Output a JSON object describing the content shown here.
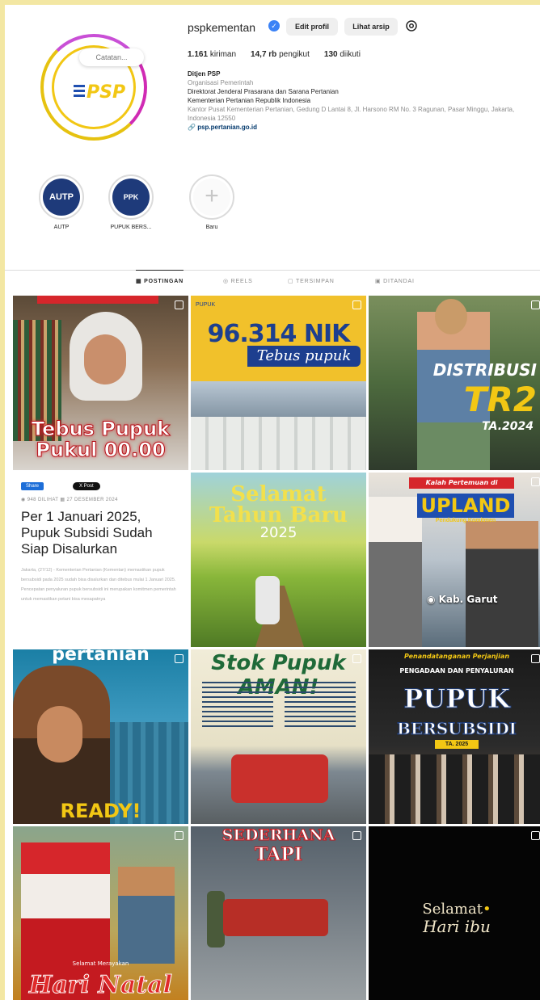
{
  "profile": {
    "username": "pspkementan",
    "note": "Catatan...",
    "avatar_text": "PSP",
    "buttons": {
      "edit": "Edit profil",
      "archive": "Lihat arsip"
    },
    "stats": {
      "posts": "1.161",
      "posts_label": "kiriman",
      "followers": "14,7 rb",
      "followers_label": "pengikut",
      "following": "130",
      "following_label": "diikuti"
    },
    "bio": {
      "name": "Ditjen PSP",
      "category": "Organisasi Pemerintah",
      "line1": "Direktorat Jenderal Prasarana dan Sarana Pertanian",
      "line2": "Kementerian Pertanian Republik Indonesia",
      "address": "Kantor Pusat Kementerian Pertanian, Gedung D Lantai 8, Jl. Harsono RM No. 3 Ragunan, Pasar Minggu, Jakarta, Indonesia 12550",
      "link": "psp.pertanian.go.id"
    }
  },
  "highlights": [
    {
      "label": "AUTP",
      "cover": "AUTP"
    },
    {
      "label": "PUPUK BERS...",
      "cover": "PPK"
    },
    {
      "label": "Baru",
      "cover": "+"
    }
  ],
  "tabs": [
    "POSTINGAN",
    "REELS",
    "TERSIMPAN",
    "DITANDAI"
  ],
  "posts": {
    "p1": {
      "title": "Tebus Pupuk Pukul 00.00"
    },
    "p2": {
      "logo": "PUPUK",
      "headline": "96.314 NIK",
      "sub": "Tebus pupuk"
    },
    "p3": {
      "line1": "DISTRIBUSI",
      "line2": "TR2",
      "line3": "TA.2024"
    },
    "p4": {
      "share": "Share",
      "x": "X Post",
      "views": "948 DILIHAT",
      "date": "27 DESEMBER 2024",
      "title": "Per 1 Januari 2025, Pupuk Subsidi Sudah Siap Disalurkan",
      "body": "Jakarta, (27/12) - Kementerian Pertanian (Kementan) memastikan pupuk bersubsidi pada 2025 sudah bisa disalurkan dan ditebus mulai 1 Januari 2025. Pencepatan penyaluran pupuk bersubsidi ini merupakan komitmen pemerintah untuk memastikan petani bisa mesapatnya"
    },
    "p5": {
      "line1": "Selamat",
      "line2": "Tahun Baru",
      "year": "2025"
    },
    "p6": {
      "banner": "Kaiah Pertemuan di",
      "title": "UPLAND",
      "sub": "Pendukung Komitmen",
      "place": "Kab. Garut"
    },
    "p7": {
      "top": "pertanian",
      "bottom": "READY!"
    },
    "p8": {
      "title": "Stok Pupuk AMAN!"
    },
    "p9": {
      "line1": "Penandatanganan Perjanjian",
      "line2": "PENGADAAN DAN PENYALURAN",
      "line3": "PUPUK",
      "line4": "BERSUBSIDI",
      "ta": "TA. 2025"
    },
    "p10": {
      "small": "Selamat Merayakan",
      "title": "Hari Natal"
    },
    "p11": {
      "line1": "SEDERHANA",
      "line2": "TAPI"
    },
    "p12": {
      "line1": "Selamat",
      "line2": "Hari ibu"
    }
  }
}
